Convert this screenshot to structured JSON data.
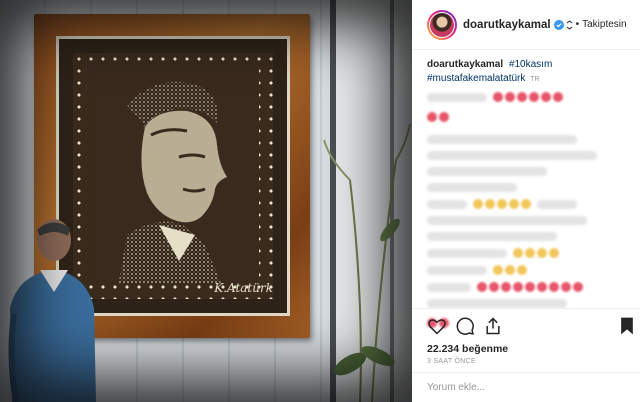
{
  "header": {
    "username": "doarutkaykamal",
    "separator": "•",
    "follow_label": "Takiptesin"
  },
  "caption": {
    "username": "doarutkaykamal",
    "tag1": "#10kasım",
    "tag2": "#mustafakemalatatürk",
    "lang_badge": "TR"
  },
  "artwork": {
    "signature": "K.Atatürk"
  },
  "likes": {
    "text": "22.234 beğenme"
  },
  "timestamp": "3 SAAT ÖNCE",
  "comment_box": {
    "placeholder": "Yorum ekle..."
  },
  "colors": {
    "link": "#003569",
    "verified": "#3897f0",
    "blurred_pink": "#e8546a",
    "blurred_yellow": "#f2c65a"
  },
  "icons": [
    "heart-icon",
    "comment-icon",
    "share-icon",
    "bookmark-icon",
    "verified-badge-icon",
    "chevron-icon"
  ]
}
